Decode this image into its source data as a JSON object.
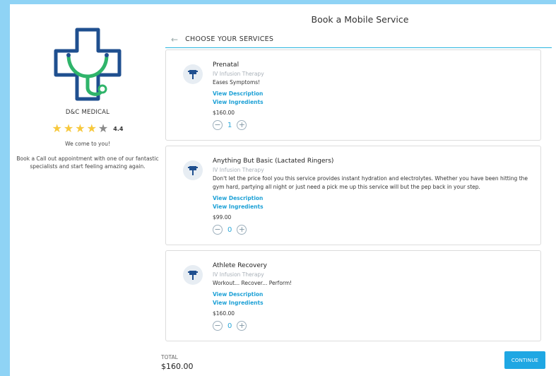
{
  "page_title": "Book a Mobile Service",
  "provider": {
    "name": "D&C MEDICAL",
    "rating": "4.4",
    "stars_filled": 4,
    "stars_total": 5,
    "tagline": "We come to you!",
    "description": "Book a Call out appointment with one of our fantastic specialists and start feeling amazing again."
  },
  "services_header": "CHOOSE YOUR SERVICES",
  "services": [
    {
      "name": "Prenatal",
      "category": "IV Infusion Therapy",
      "description": "Eases Symptoms!",
      "view_description": "View Description",
      "view_ingredients": "View Ingredients",
      "price": "$160.00",
      "quantity": "1"
    },
    {
      "name": "Anything But Basic (Lactated Ringers)",
      "category": "IV Infusion Therapy",
      "description": "Don't let the price fool you this service provides instant hydration and electrolytes. Whether you have been hitting the gym hard, partying all night or just need a pick me up this service will but the pep back in your step.",
      "view_description": "View Description",
      "view_ingredients": "View Ingredients",
      "price": "$99.00",
      "quantity": "0"
    },
    {
      "name": "Athlete Recovery",
      "category": "IV Infusion Therapy",
      "description": "Workout... Recover... Perform!",
      "view_description": "View Description",
      "view_ingredients": "View Ingredients",
      "price": "$160.00",
      "quantity": "0"
    }
  ],
  "footer": {
    "total_label": "TOTAL",
    "total_value": "$160.00",
    "continue_label": "CONTINUE"
  },
  "colors": {
    "background": "#8fd3f5",
    "accent": "#1fa7e3",
    "logo_blue": "#1f4f8f",
    "logo_green": "#2fb46a",
    "star": "#f7c83c"
  }
}
